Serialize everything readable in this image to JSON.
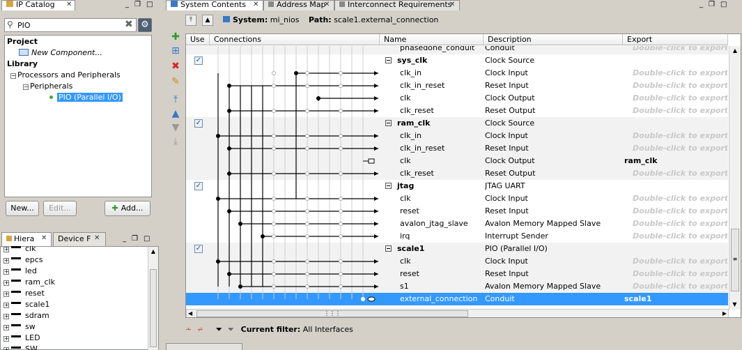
{
  "ip_catalog": {
    "tab_title": "IP Catalog",
    "search_value": "PIO",
    "tree": {
      "project_label": "Project",
      "new_component": "New Component...",
      "library_label": "Library",
      "processors": "Processors and Peripherals",
      "peripherals": "Peripherals",
      "pio": "PIO (Parallel I/O)"
    },
    "buttons": {
      "new": "New...",
      "edit": "Edit...",
      "add": "Add..."
    }
  },
  "hierarchy": {
    "tabs": [
      {
        "label": "Hiera"
      },
      {
        "label": "Device F"
      }
    ],
    "items": [
      "clk",
      "epcs",
      "led",
      "ram_clk",
      "reset",
      "scale1",
      "sdram",
      "sw",
      "LED",
      "SW"
    ]
  },
  "system_contents": {
    "tabs": [
      "System Contents",
      "Address Map",
      "Interconnect Requirements"
    ],
    "system_label": "System:",
    "system_name": "mi_nios",
    "path_label": "Path:",
    "path_value": "scale1.external_connection",
    "columns": {
      "use": "Use",
      "connections": "Connections",
      "name": "Name",
      "description": "Description",
      "export": "Export"
    },
    "rows": [
      {
        "name": "phasedone_conduit",
        "desc": "Conduit",
        "export": "Double-click to export",
        "group": true,
        "top": false
      },
      {
        "name": "sys_clk",
        "desc": "Clock Source",
        "export": "",
        "group": false,
        "top": true
      },
      {
        "name": "clk_in",
        "desc": "Clock Input",
        "export": "Double-click to export",
        "group": false,
        "top": false
      },
      {
        "name": "clk_in_reset",
        "desc": "Reset Input",
        "export": "Double-click to export",
        "group": false,
        "top": false
      },
      {
        "name": "clk",
        "desc": "Clock Output",
        "export": "Double-click to export",
        "group": false,
        "top": false
      },
      {
        "name": "clk_reset",
        "desc": "Reset Output",
        "export": "Double-click to export",
        "group": false,
        "top": false
      },
      {
        "name": "ram_clk",
        "desc": "Clock Source",
        "export": "",
        "group": true,
        "top": true
      },
      {
        "name": "clk_in",
        "desc": "Clock Input",
        "export": "Double-click to export",
        "group": true,
        "top": false
      },
      {
        "name": "clk_in_reset",
        "desc": "Reset Input",
        "export": "Double-click to export",
        "group": true,
        "top": false
      },
      {
        "name": "clk",
        "desc": "Clock Output",
        "export": "ram_clk",
        "group": true,
        "top": false,
        "exported": true
      },
      {
        "name": "clk_reset",
        "desc": "Reset Output",
        "export": "Double-click to export",
        "group": true,
        "top": false
      },
      {
        "name": "jtag",
        "desc": "JTAG UART",
        "export": "",
        "group": false,
        "top": true
      },
      {
        "name": "clk",
        "desc": "Clock Input",
        "export": "Double-click to export",
        "group": false,
        "top": false
      },
      {
        "name": "reset",
        "desc": "Reset Input",
        "export": "Double-click to export",
        "group": false,
        "top": false
      },
      {
        "name": "avalon_jtag_slave",
        "desc": "Avalon Memory Mapped Slave",
        "export": "Double-click to export",
        "group": false,
        "top": false
      },
      {
        "name": "irq",
        "desc": "Interrupt Sender",
        "export": "Double-click to export",
        "group": false,
        "top": false
      },
      {
        "name": "scale1",
        "desc": "PIO (Parallel I/O)",
        "export": "",
        "group": true,
        "top": true
      },
      {
        "name": "clk",
        "desc": "Clock Input",
        "export": "Double-click to export",
        "group": true,
        "top": false
      },
      {
        "name": "reset",
        "desc": "Reset Input",
        "export": "Double-click to export",
        "group": true,
        "top": false
      },
      {
        "name": "s1",
        "desc": "Avalon Memory Mapped Slave",
        "export": "Double-click to export",
        "group": true,
        "top": false
      },
      {
        "name": "external_connection",
        "desc": "Conduit",
        "export": "scale1",
        "group": false,
        "top": false,
        "exported": true,
        "selected": true
      }
    ],
    "filter_label": "Current filter:",
    "filter_value": "All Interfaces"
  }
}
